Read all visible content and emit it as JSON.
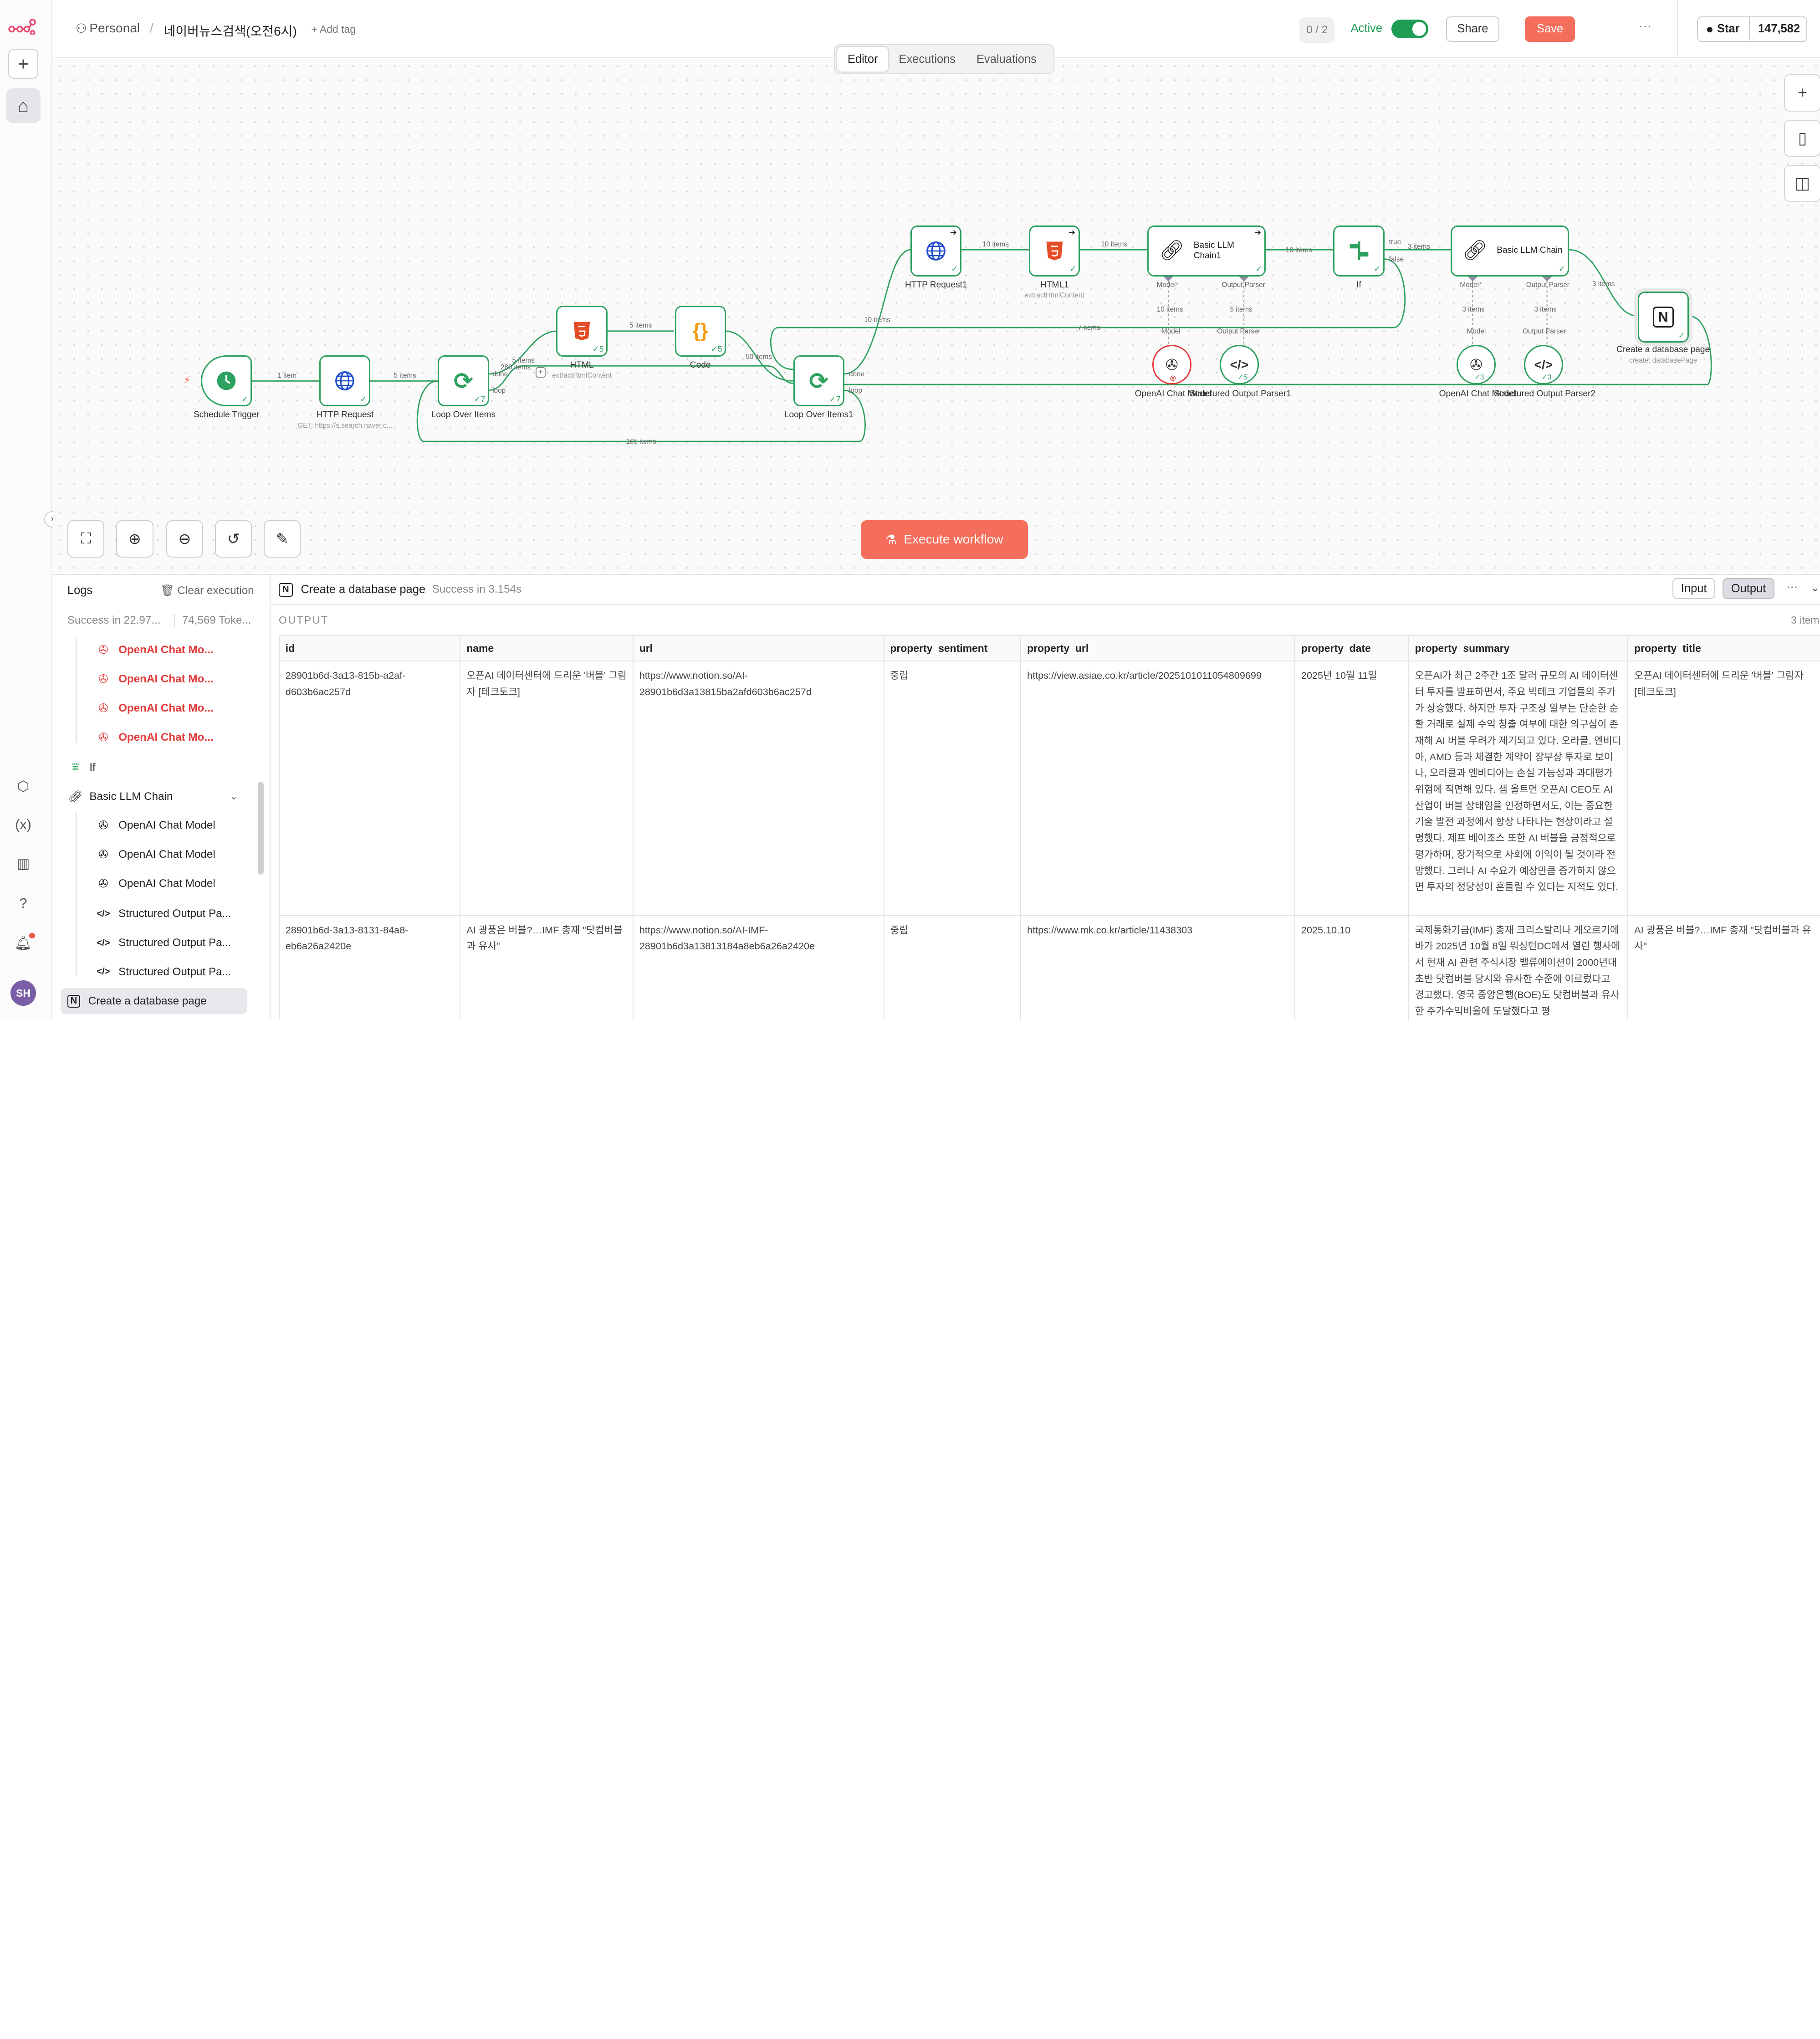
{
  "topbar": {
    "workspace": "Personal",
    "workflow_name": "네이버뉴스검색(오전6시)",
    "add_tag": "+ Add tag",
    "counter": "0 / 2",
    "active_label": "Active",
    "share": "Share",
    "save": "Save",
    "more": "···",
    "star": "Star",
    "star_count": "147,582"
  },
  "tabs": [
    "Editor",
    "Executions",
    "Evaluations"
  ],
  "nodes": {
    "schedule": "Schedule Trigger",
    "http": "HTTP Request",
    "http_sub": "GET: https://s.search.naver.c...",
    "loop": "Loop Over Items",
    "html": "HTML",
    "html_sub": "extractHtmlContent",
    "code": "Code",
    "loop1": "Loop Over Items1",
    "http1": "HTTP Request1",
    "html1": "HTML1",
    "html1_sub": "extractHtmlContent",
    "llm1": "Basic LLM Chain1",
    "if": "If",
    "llm": "Basic LLM Chain",
    "notion": "Create a database page",
    "notion_sub": "create: databasePage",
    "openai1": "OpenAI Chat Model",
    "parser1": "Structured Output Parser1",
    "openai": "OpenAI Chat Model",
    "parser2": "Structured Output Parser2"
  },
  "edges": {
    "e1": "1 item",
    "e2": "5 items",
    "e3": "5 items",
    "e3b": "280 items",
    "e4": "5 items",
    "e5": "50 items",
    "e6": "10 items",
    "e7": "10 items",
    "e8": "10 items",
    "e9": "10 items",
    "e10": "3 items",
    "e11": "3 items",
    "e12": "7 items",
    "e13": "165 items",
    "m1": "10 items",
    "p1": "5 items",
    "m2": "3 items",
    "p2": "3 items",
    "done": "done",
    "loop": "loop",
    "true": "true",
    "false": "false",
    "model": "Model",
    "model_req": "Model*",
    "output_parser": "Output Parser"
  },
  "execute": "Execute workflow",
  "logs": {
    "title": "Logs",
    "clear": "Clear execution",
    "summary": "Success in 22.97...",
    "tokens": "74,569 Toke...",
    "items": [
      {
        "label": "OpenAI Chat Mo...",
        "error": true
      },
      {
        "label": "OpenAI Chat Mo...",
        "error": true
      },
      {
        "label": "OpenAI Chat Mo...",
        "error": true
      },
      {
        "label": "OpenAI Chat Mo...",
        "error": true
      },
      {
        "label": "If",
        "error": false
      },
      {
        "label": "Basic LLM Chain",
        "error": false
      },
      {
        "label": "OpenAI Chat Model",
        "error": false
      },
      {
        "label": "OpenAI Chat Model",
        "error": false
      },
      {
        "label": "OpenAI Chat Model",
        "error": false
      },
      {
        "label": "Structured Output Pa...",
        "error": false
      },
      {
        "label": "Structured Output Pa...",
        "error": false
      },
      {
        "label": "Structured Output Pa...",
        "error": false
      },
      {
        "label": "Create a database page",
        "error": false
      }
    ]
  },
  "panel": {
    "node_name": "Create a database page",
    "status": "Success in 3.154s",
    "input": "Input",
    "output": "Output",
    "more": "···",
    "section": "OUTPUT",
    "items": "3 item",
    "columns": [
      "id",
      "name",
      "url",
      "property_sentiment",
      "property_url",
      "property_date",
      "property_summary",
      "property_title"
    ],
    "rows": [
      [
        "28901b6d-3a13-815b-a2af-d603b6ac257d",
        "오픈AI 데이터센터에 드리운 '버블' 그림자 [테크토크]",
        "https://www.notion.so/AI-28901b6d3a13815ba2afd603b6ac257d",
        "중립",
        "https://view.asiae.co.kr/article/2025101011054809699",
        "2025년 10월 11일",
        "오픈AI가 최근 2주간 1조 달러 규모의 AI 데이터센터 투자를 발표하면서, 주요 빅테크 기업들의 주가가 상승했다. 하지만 투자 구조상 일부는 단순한 순환 거래로 실제 수익 창출 여부에 대한 의구심이 존재해 AI 버블 우려가 제기되고 있다. 오라클, 엔비디아, AMD 등과 체결한 계약이 장부상 투자로 보이나, 오라클과 엔비디아는 손실 가능성과 과대평가 위험에 직면해 있다. 샘 올트먼 오픈AI CEO도 AI 산업이 버블 상태임을 인정하면서도, 이는 중요한 기술 발전 과정에서 항상 나타나는 현상이라고 설명했다. 제프 베이조스 또한 AI 버블을 긍정적으로 평가하며, 장기적으로 사회에 이익이 될 것이라 전망했다. 그러나 AI 수요가 예상만큼 증가하지 않으면 투자의 정당성이 흔들릴 수 있다는 지적도 있다.",
        "오픈AI 데이터센터에 드리운 '버블' 그림자 [테크토크]"
      ],
      [
        "28901b6d-3a13-8131-84a8-eb6a26a2420e",
        "AI 광풍은 버블?…IMF 총재 \"닷컴버블과 유사\"",
        "https://www.notion.so/AI-IMF-28901b6d3a13813184a8eb6a26a2420e",
        "중립",
        "https://www.mk.co.kr/article/11438303",
        "2025.10.10",
        "국제통화기금(IMF) 총재 크리스탈리나 게오르기에바가 2025년 10월 8일 워싱턴DC에서 열린 행사에서 현재 AI 관련 주식시장 밸류에이션이 2000년대 초반 닷컴버블 당시와 유사한 수준에 이르렀다고 경고했다. 영국 중앙은행(BOE)도 닷컴버블과 유사한 주가수익비율에 도달했다고 평",
        "AI 광풍은 버블?…IMF 총재 \"닷컴버블과 유사\""
      ]
    ]
  }
}
